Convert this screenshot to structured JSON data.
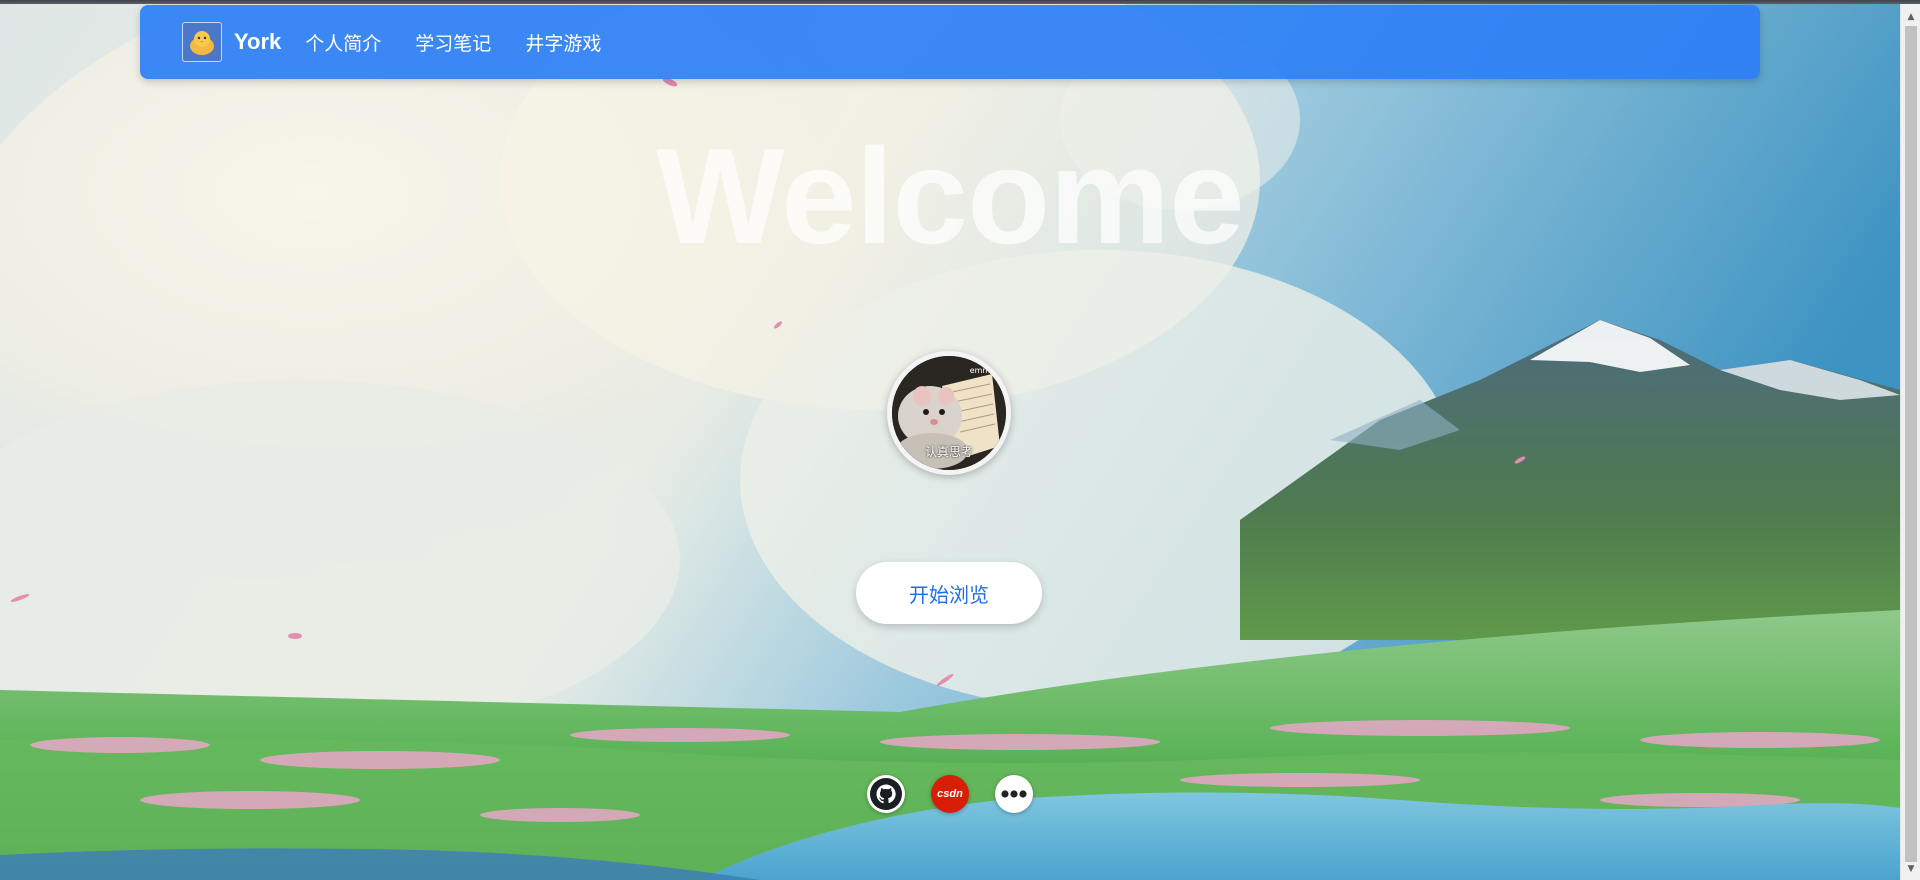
{
  "brand": {
    "name": "York"
  },
  "nav": {
    "items": [
      {
        "label": "个人简介"
      },
      {
        "label": "学习笔记"
      },
      {
        "label": "井字游戏"
      }
    ]
  },
  "hero": {
    "title": "Welcome"
  },
  "avatar": {
    "caption": "认真思考",
    "corner_text": "emmm"
  },
  "cta": {
    "label": "开始浏览"
  },
  "social": {
    "csdn_label": "csdn"
  },
  "colors": {
    "nav_bg": "#2d80f5",
    "cta_text": "#1f6fe6",
    "csdn_red": "#d81e06"
  }
}
